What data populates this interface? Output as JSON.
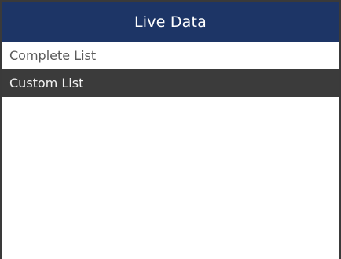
{
  "header": {
    "title": "Live Data",
    "background_color": "#1d3566"
  },
  "menu": {
    "items": [
      {
        "label": "Complete List",
        "selected": false
      },
      {
        "label": "Custom List",
        "selected": true
      }
    ],
    "selected_color": "#3b3b3b"
  }
}
